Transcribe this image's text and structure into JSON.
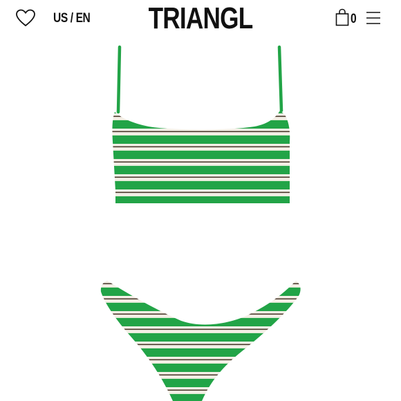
{
  "header": {
    "locale": "US / EN",
    "brand": "TRIANGL",
    "cart_count": "0"
  },
  "icons": {
    "wishlist": "heart-icon",
    "cart": "shopping-bag-icon",
    "menu": "hamburger-menu-icon"
  },
  "product_image": {
    "colors": {
      "green": "#22a447",
      "cream": "#f4efe6",
      "brown": "#4a3a2c"
    }
  }
}
